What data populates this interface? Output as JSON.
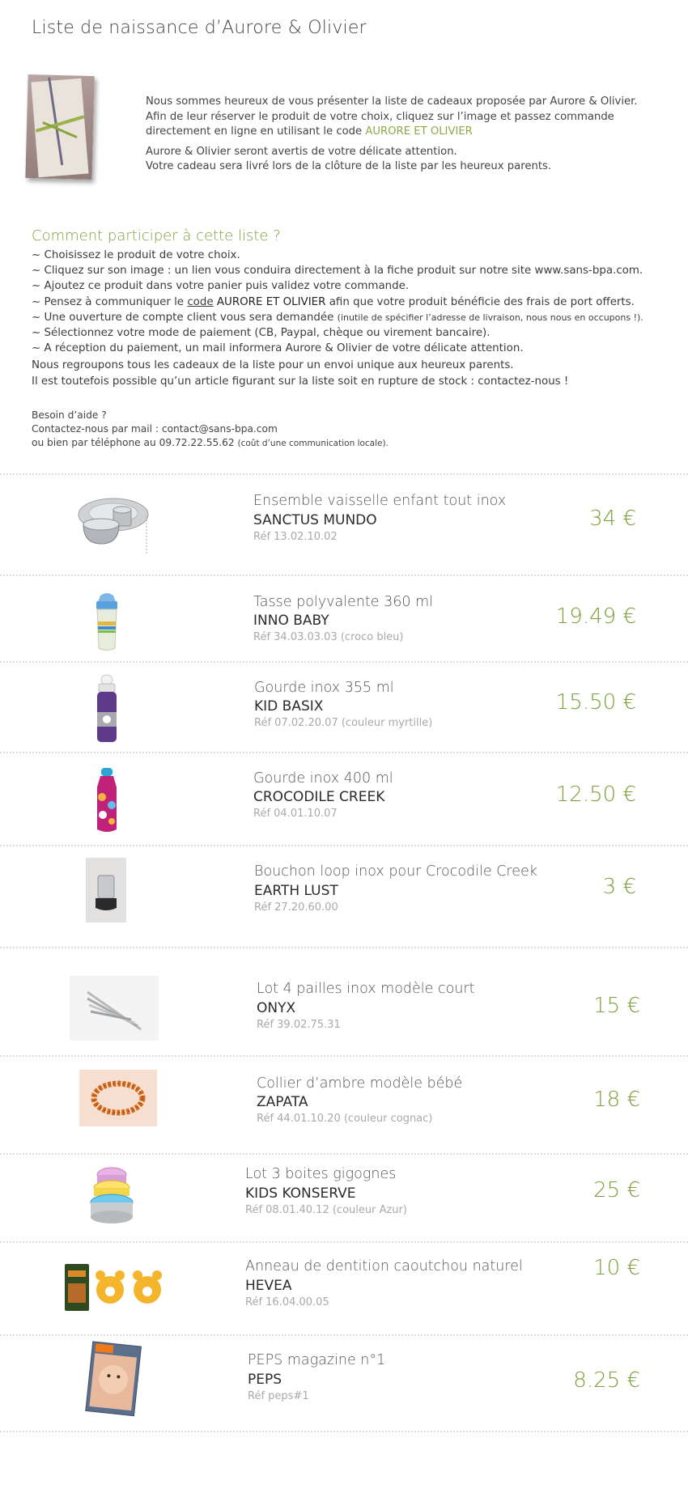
{
  "page": {
    "title": "Liste de naissance d’Aurore & Olivier"
  },
  "intro": {
    "line1": "Nous sommes heureux de vous présenter la liste de cadeaux proposée par Aurore & Olivier.",
    "line2": "Afin de leur réserver le produit de votre choix, cliquez sur l’image et passez commande",
    "line3_prefix": "directement en ligne en utilisant le code ",
    "code": "AURORE ET OLIVIER",
    "line4": "Aurore & Olivier seront avertis de votre délicate attention.",
    "line5": "Votre cadeau sera livré lors de la clôture de la liste par les heureux parents."
  },
  "howto": {
    "heading": "Comment participer à cette liste ?",
    "step1": "~ Choisissez le produit de votre choix.",
    "step2": "~ Cliquez sur son image : un lien vous conduira directement à la fiche produit sur notre site www.sans-bpa.com.",
    "step3": "~ Ajoutez ce produit dans votre panier puis validez votre commande.",
    "step4_prefix": "~ Pensez à communiquer le ",
    "step4_link": "code",
    "step4_code": "AURORE ET OLIVIER",
    "step4_suffix": " afin que votre produit bénéficie des frais de port offerts.",
    "step5_main": "~ Une ouverture de compte client vous sera demandée ",
    "step5_small": "(inutile de spécifier l’adresse de livraison, nous nous en occupons !).",
    "step6": "~ Sélectionnez votre mode de paiement (CB, Paypal, chèque ou virement bancaire).",
    "step7": "~ A réception du paiement, un mail informera Aurore & Olivier de votre délicate attention.",
    "note1": "Nous regroupons tous les cadeaux de la liste pour un envoi unique aux heureux parents.",
    "note2": "Il est toutefois possible qu’un article figurant sur la liste soit en rupture de stock : contactez-nous !"
  },
  "help": {
    "title": "Besoin d’aide ?",
    "mail": "Contactez-nous par mail : contact@sans-bpa.com",
    "phone": "ou bien par téléphone au 09.72.22.55.62 ",
    "phone_small": "(coût d’une communication locale)."
  },
  "items": [
    {
      "name": "Ensemble vaisselle enfant tout inox",
      "brand": "SANCTUS MUNDO",
      "ref": "Réf 13.02.10.02",
      "price": "34 €",
      "icon": "tableware-set-icon"
    },
    {
      "name": "Tasse polyvalente 360 ml",
      "brand": "INNO BABY",
      "ref": "Réf 34.03.03.03 (croco bleu)",
      "price": "19.49 €",
      "icon": "sippy-cup-icon"
    },
    {
      "name": "Gourde inox 355 ml",
      "brand": "KID BASIX",
      "ref": "Réf 07.02.20.07 (couleur myrtille)",
      "price": "15.50 €",
      "icon": "purple-bottle-icon"
    },
    {
      "name": "Gourde inox 400 ml",
      "brand": "CROCODILE CREEK",
      "ref": "Réf 04.01.10.07",
      "price": "12.50 €",
      "icon": "pink-bottle-icon"
    },
    {
      "name": "Bouchon loop inox pour Crocodile Creek",
      "brand": "EARTH LUST",
      "ref": "Réf 27.20.60.00",
      "price": "3 €",
      "icon": "bottle-cap-icon"
    },
    {
      "name": "Lot 4 pailles inox modèle court",
      "brand": "ONYX",
      "ref": "Réf 39.02.75.31",
      "price": "15 €",
      "icon": "straws-icon"
    },
    {
      "name": "Collier d’ambre modèle bébé",
      "brand": "ZAPATA",
      "ref": "Réf 44.01.10.20 (couleur cognac)",
      "price": "18 €",
      "icon": "amber-necklace-icon"
    },
    {
      "name": "Lot 3 boites gigognes",
      "brand": "KIDS KONSERVE",
      "ref": "Réf 08.01.40.12 (couleur Azur)",
      "price": "25 €",
      "icon": "nesting-boxes-icon"
    },
    {
      "name": "Anneau de dentition caoutchou naturel",
      "brand": "HEVEA",
      "ref": "Réf 16.04.00.05",
      "price": "10 €",
      "icon": "teething-ring-icon"
    },
    {
      "name": "PEPS magazine n°1",
      "brand": "PEPS",
      "ref": "Réf peps#1",
      "price": "8.25 €",
      "icon": "magazine-icon"
    }
  ],
  "colors": {
    "accent": "#7ea03a",
    "text": "#3a3a3a",
    "muted": "#a9a9a9",
    "separator": "#dcdcdc"
  }
}
